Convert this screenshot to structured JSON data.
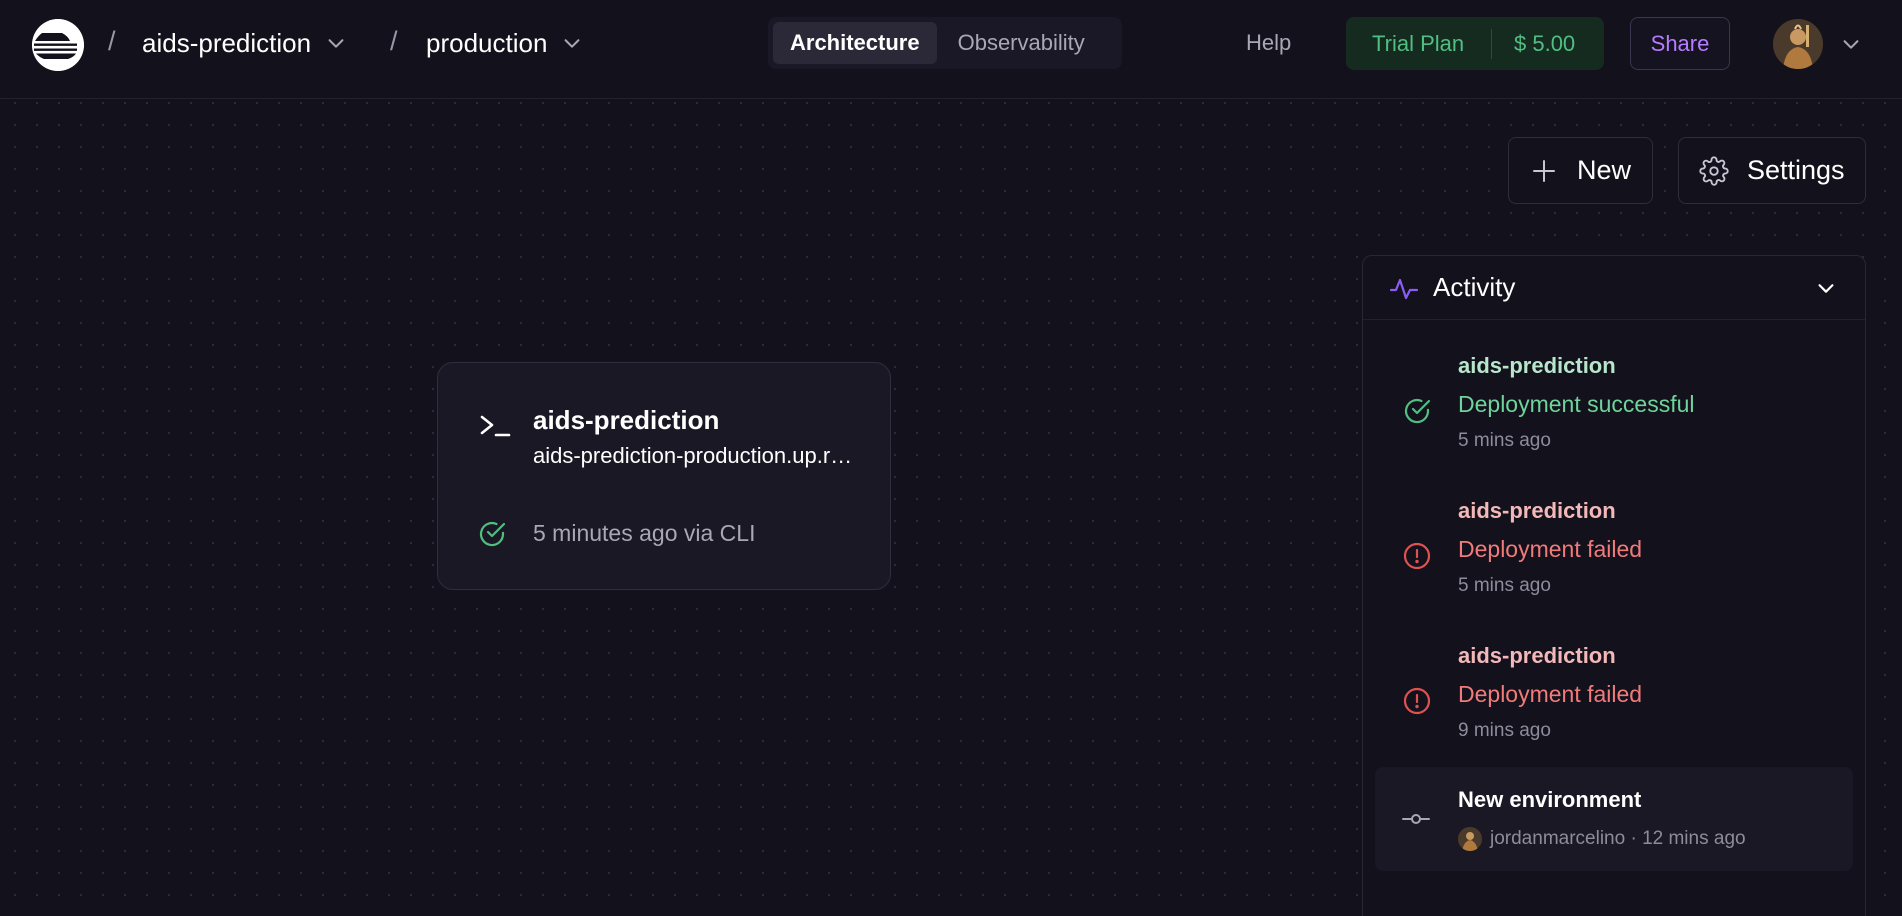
{
  "topbar": {
    "project": "aids-prediction",
    "environment": "production",
    "separator": "/",
    "tabs": [
      {
        "label": "Architecture",
        "active": true
      },
      {
        "label": "Observability",
        "active": false
      }
    ],
    "help_label": "Help",
    "plan": {
      "name": "Trial Plan",
      "amount": "$ 5.00"
    },
    "share_label": "Share"
  },
  "actions": {
    "new_label": "New",
    "settings_label": "Settings"
  },
  "service": {
    "name": "aids-prediction",
    "url": "aids-prediction-production.up.railway.app",
    "status": "5 minutes ago via CLI",
    "status_color": "#4fbf82"
  },
  "activity": {
    "title": "Activity",
    "items": [
      {
        "name": "aids-prediction",
        "status": "Deployment successful",
        "time": "5 mins ago",
        "state": "success"
      },
      {
        "name": "aids-prediction",
        "status": "Deployment failed",
        "time": "5 mins ago",
        "state": "failed"
      },
      {
        "name": "aids-prediction",
        "status": "Deployment failed",
        "time": "9 mins ago",
        "state": "failed"
      }
    ],
    "environment_event": {
      "title": "New environment",
      "user": "jordanmarcelino",
      "time": "12 mins ago",
      "meta": "jordanmarcelino · 12 mins ago"
    }
  },
  "colors": {
    "background": "#13111c",
    "success": "#4fbf82",
    "failure": "#e05252",
    "accent": "#b47cff",
    "activity_icon": "#8b5cf6"
  },
  "icons": {
    "logo": "railway-logo-icon",
    "terminal": "terminal-icon",
    "new": "plus-icon",
    "settings": "gear-icon",
    "activity": "pulse-icon",
    "success": "check-circle-icon",
    "failed": "alert-circle-icon",
    "environment": "commit-icon"
  }
}
